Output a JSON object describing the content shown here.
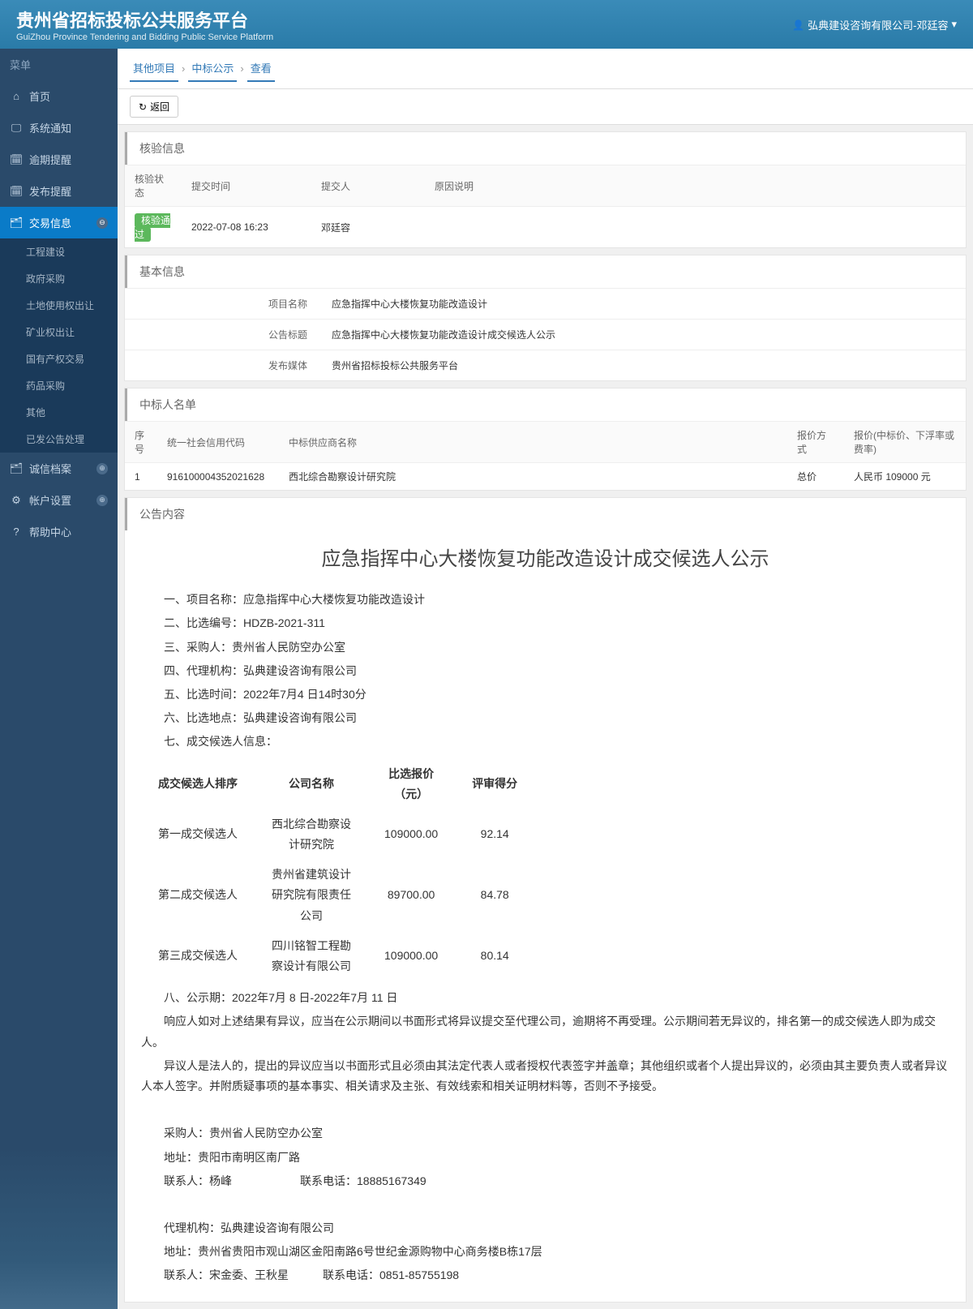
{
  "header": {
    "title": "贵州省招标投标公共服务平台",
    "subtitle": "GuiZhou Province Tendering and Bidding Public Service Platform",
    "user": "弘典建设咨询有限公司-邓廷容"
  },
  "sidebar": {
    "menu_label": "菜单",
    "items": [
      {
        "label": "首页",
        "icon": "⌂"
      },
      {
        "label": "系统通知",
        "icon": "🖵"
      },
      {
        "label": "逾期提醒",
        "icon": "🗓"
      },
      {
        "label": "发布提醒",
        "icon": "🗓"
      },
      {
        "label": "交易信息",
        "icon": "🗂",
        "active": true,
        "expand": "⊖"
      },
      {
        "label": "诚信档案",
        "icon": "🗂",
        "expand": "⊕"
      },
      {
        "label": "帐户设置",
        "icon": "⚙",
        "expand": "⊕"
      },
      {
        "label": "帮助中心",
        "icon": "?"
      }
    ],
    "submenu": [
      "工程建设",
      "政府采购",
      "土地使用权出让",
      "矿业权出让",
      "国有产权交易",
      "药品采购",
      "其他",
      "已发公告处理"
    ]
  },
  "breadcrumb": {
    "items": [
      "其他项目",
      "中标公示",
      "查看"
    ]
  },
  "toolbar": {
    "back": "返回"
  },
  "panels": {
    "verify": {
      "title": "核验信息",
      "headers": [
        "核验状态",
        "提交时间",
        "提交人",
        "原因说明"
      ],
      "row": {
        "status": "核验通过",
        "time": "2022-07-08 16:23",
        "person": "邓廷容",
        "reason": ""
      }
    },
    "basic": {
      "title": "基本信息",
      "rows": [
        {
          "label": "项目名称",
          "value": "应急指挥中心大楼恢复功能改造设计"
        },
        {
          "label": "公告标题",
          "value": "应急指挥中心大楼恢复功能改造设计成交候选人公示"
        },
        {
          "label": "发布媒体",
          "value": "贵州省招标投标公共服务平台"
        }
      ]
    },
    "bidders": {
      "title": "中标人名单",
      "headers": [
        "序号",
        "统一社会信用代码",
        "中标供应商名称",
        "报价方式",
        "报价(中标价、下浮率或费率)"
      ],
      "row": {
        "no": "1",
        "code": "916100004352021628",
        "name": "西北综合勘察设计研究院",
        "method": "总价",
        "price": "人民币 109000 元"
      }
    },
    "content": {
      "title": "公告内容",
      "doc_title": "应急指挥中心大楼恢复功能改造设计成交候选人公示",
      "lines": [
        "一、项目名称：应急指挥中心大楼恢复功能改造设计",
        "二、比选编号：HDZB-2021-311",
        "三、采购人：贵州省人民防空办公室",
        "四、代理机构：弘典建设咨询有限公司",
        "五、比选时间：2022年7月4 日14时30分",
        "六、比选地点：弘典建设咨询有限公司",
        "七、成交候选人信息："
      ],
      "table_headers": [
        "成交候选人排序",
        "公司名称",
        "比选报价（元）",
        "评审得分"
      ],
      "table_rows": [
        {
          "rank": "第一成交候选人",
          "company": "西北综合勘察设计研究院",
          "price": "109000.00",
          "score": "92.14"
        },
        {
          "rank": "第二成交候选人",
          "company": "贵州省建筑设计研究院有限责任公司",
          "price": "89700.00",
          "score": "84.78"
        },
        {
          "rank": "第三成交候选人",
          "company": "四川铭智工程勘察设计有限公司",
          "price": "109000.00",
          "score": "80.14"
        }
      ],
      "period": "八、公示期：2022年7月 8 日-2022年7月 11 日",
      "para1": "响应人如对上述结果有异议，应当在公示期间以书面形式将异议提交至代理公司，逾期将不再受理。公示期间若无异议的，排名第一的成交候选人即为成交人。",
      "para2": "异议人是法人的，提出的异议应当以书面形式且必须由其法定代表人或者授权代表签字并盖章；其他组织或者个人提出异议的，必须由其主要负责人或者异议人本人签字。并附质疑事项的基本事实、相关请求及主张、有效线索和相关证明材料等，否则不予接受。",
      "buyer_lines": [
        "采购人：贵州省人民防空办公室",
        "地址：贵阳市南明区南厂路",
        "联系人：杨峰　　　　　　联系电话：18885167349"
      ],
      "agent_lines": [
        "代理机构：弘典建设咨询有限公司",
        "地址：贵州省贵阳市观山湖区金阳南路6号世纪金源购物中心商务楼B栋17层",
        "联系人：宋金委、王秋星　　　联系电话：0851-85755198"
      ]
    }
  }
}
